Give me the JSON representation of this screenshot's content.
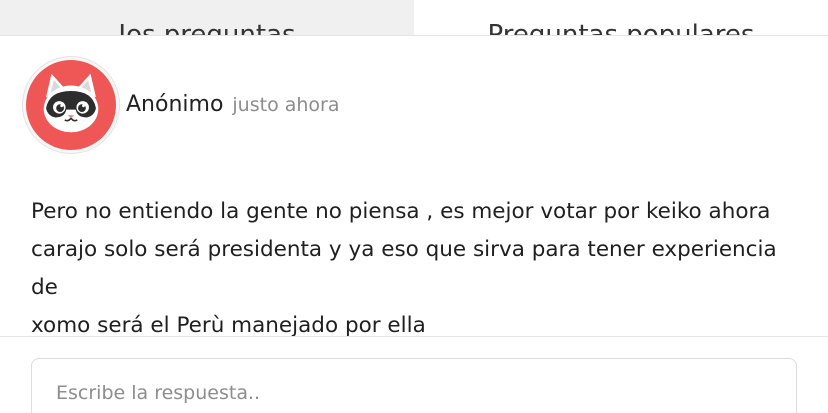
{
  "tabs": {
    "left_label": "Ios preguntas",
    "right_label": "Preguntas populares"
  },
  "post": {
    "author": "Anónimo",
    "time": "justo ahora",
    "lines": [
      "Pero no entiendo la gente no piensa , es mejor votar por keiko ahora",
      "carajo solo será presidenta y ya eso que sirva para tener experiencia de",
      "xomo será el Perù manejado por ella"
    ]
  },
  "answer": {
    "placeholder": "Escribe la respuesta.."
  },
  "colors": {
    "avatar_bg": "#ef5656",
    "tab_inactive_bg": "#f0f0f0",
    "muted_text": "#8c8c8c"
  },
  "icons": {
    "avatar": "cat-face-icon"
  }
}
